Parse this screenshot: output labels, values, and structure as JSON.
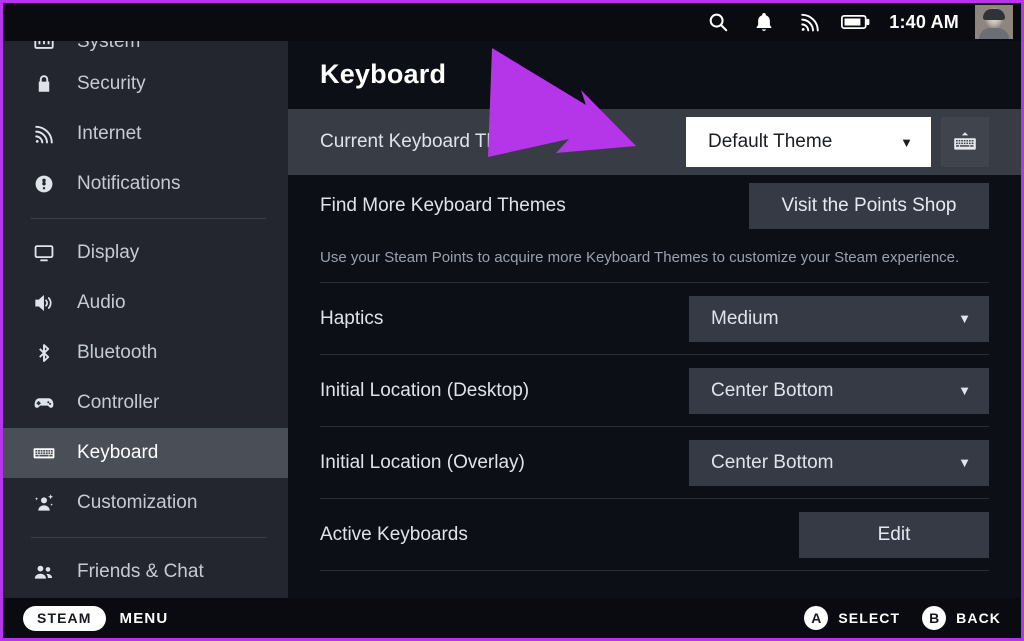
{
  "statusbar": {
    "icons": [
      "search-icon",
      "notification-bell-icon",
      "wifi-icon",
      "battery-icon"
    ],
    "clock": "1:40 AM",
    "avatar_alt": "user-avatar"
  },
  "sidebar": {
    "items": [
      {
        "label": "System",
        "icon": "system-icon",
        "active": false,
        "clipped": true
      },
      {
        "label": "Security",
        "icon": "lock-icon",
        "active": false
      },
      {
        "label": "Internet",
        "icon": "wifi-icon",
        "active": false
      },
      {
        "label": "Notifications",
        "icon": "notification-icon",
        "active": false
      },
      {
        "divider": true
      },
      {
        "label": "Display",
        "icon": "display-icon",
        "active": false
      },
      {
        "label": "Audio",
        "icon": "audio-icon",
        "active": false
      },
      {
        "label": "Bluetooth",
        "icon": "bluetooth-icon",
        "active": false
      },
      {
        "label": "Controller",
        "icon": "controller-icon",
        "active": false
      },
      {
        "label": "Keyboard",
        "icon": "keyboard-icon",
        "active": true
      },
      {
        "label": "Customization",
        "icon": "customization-icon",
        "active": false
      },
      {
        "divider": true
      },
      {
        "label": "Friends & Chat",
        "icon": "friends-icon",
        "active": false,
        "clipped": true
      }
    ]
  },
  "main": {
    "title": "Keyboard",
    "rows": {
      "current_theme": {
        "label": "Current Keyboard Theme",
        "value": "Default Theme",
        "caret": "▼",
        "keyboard_button_icon": "show-keyboard-icon"
      },
      "find_themes": {
        "label": "Find More Keyboard Themes",
        "button": "Visit the Points Shop",
        "helper": "Use your Steam Points to acquire more Keyboard Themes to customize your Steam experience."
      },
      "haptics": {
        "label": "Haptics",
        "value": "Medium",
        "caret": "▼"
      },
      "initial_location_desktop": {
        "label": "Initial Location (Desktop)",
        "value": "Center Bottom",
        "caret": "▼"
      },
      "initial_location_overlay": {
        "label": "Initial Location (Overlay)",
        "value": "Center Bottom",
        "caret": "▼"
      },
      "active_keyboards": {
        "label": "Active Keyboards",
        "button": "Edit"
      }
    }
  },
  "bottombar": {
    "steam_pill": "STEAM",
    "menu_label": "MENU",
    "hints": [
      {
        "badge": "A",
        "label": "SELECT"
      },
      {
        "badge": "B",
        "label": "BACK"
      }
    ]
  },
  "annotation": {
    "arrow_color": "#b536e8",
    "arrow_target": "current-theme-dropdown"
  },
  "colors": {
    "accent_purple": "#b536e8",
    "sidebar_bg": "#23262e",
    "content_bg": "#0d0f16",
    "active_row": "#383c45",
    "dropdown_bg": "#353a44",
    "focused_dropdown_bg": "#ffffff"
  }
}
